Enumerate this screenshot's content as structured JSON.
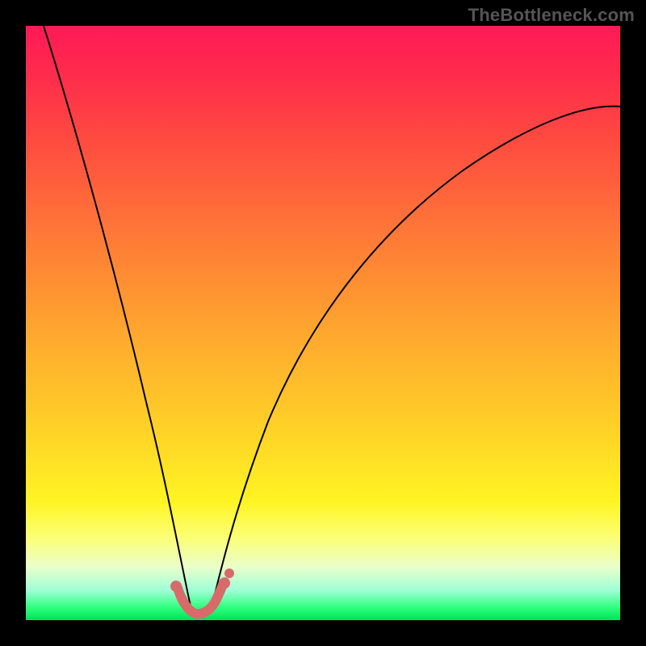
{
  "watermark": "TheBottleneck.com",
  "colors": {
    "frame_bg": "#000000",
    "curve": "#000000",
    "marker": "#d86a6a",
    "gradient_top": "#ff1a56",
    "gradient_bottom": "#00e05a"
  },
  "chart_data": {
    "type": "line",
    "title": "",
    "xlabel": "",
    "ylabel": "",
    "xlim": [
      0,
      100
    ],
    "ylim": [
      0,
      100
    ],
    "grid": false,
    "legend": false,
    "series": [
      {
        "name": "left-curve",
        "x": [
          3,
          6,
          9,
          12,
          15,
          18,
          21,
          23,
          25,
          26.5,
          28
        ],
        "y": [
          100,
          85,
          70,
          56,
          43,
          31,
          20,
          12,
          6,
          3,
          1
        ]
      },
      {
        "name": "right-curve",
        "x": [
          31,
          33,
          36,
          40,
          46,
          54,
          64,
          76,
          88,
          100
        ],
        "y": [
          1,
          6,
          15,
          27,
          41,
          54,
          65,
          74,
          81,
          86
        ]
      },
      {
        "name": "valley-marker",
        "x": [
          25.5,
          26.5,
          28,
          29.5,
          31,
          32,
          33
        ],
        "y": [
          5,
          2,
          0.5,
          0.3,
          0.5,
          2,
          5
        ]
      }
    ],
    "annotations": [
      {
        "text": "TheBottleneck.com",
        "position": "top-right"
      }
    ]
  }
}
